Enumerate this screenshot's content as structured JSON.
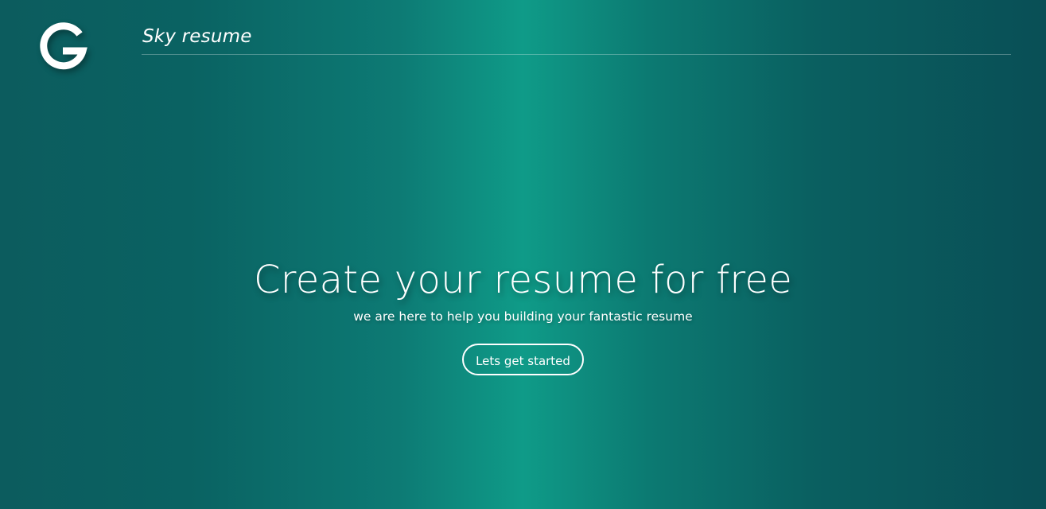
{
  "header": {
    "logo_icon": "g-logo-icon",
    "brand_name": "Sky resume"
  },
  "hero": {
    "title": "Create your resume for free",
    "subtitle": "we are here to help you building your fantastic resume",
    "cta_label": "Lets get started"
  },
  "colors": {
    "gradient_edge": "#0a5c5e",
    "gradient_center": "#0f9b88",
    "text": "#ffffff"
  }
}
